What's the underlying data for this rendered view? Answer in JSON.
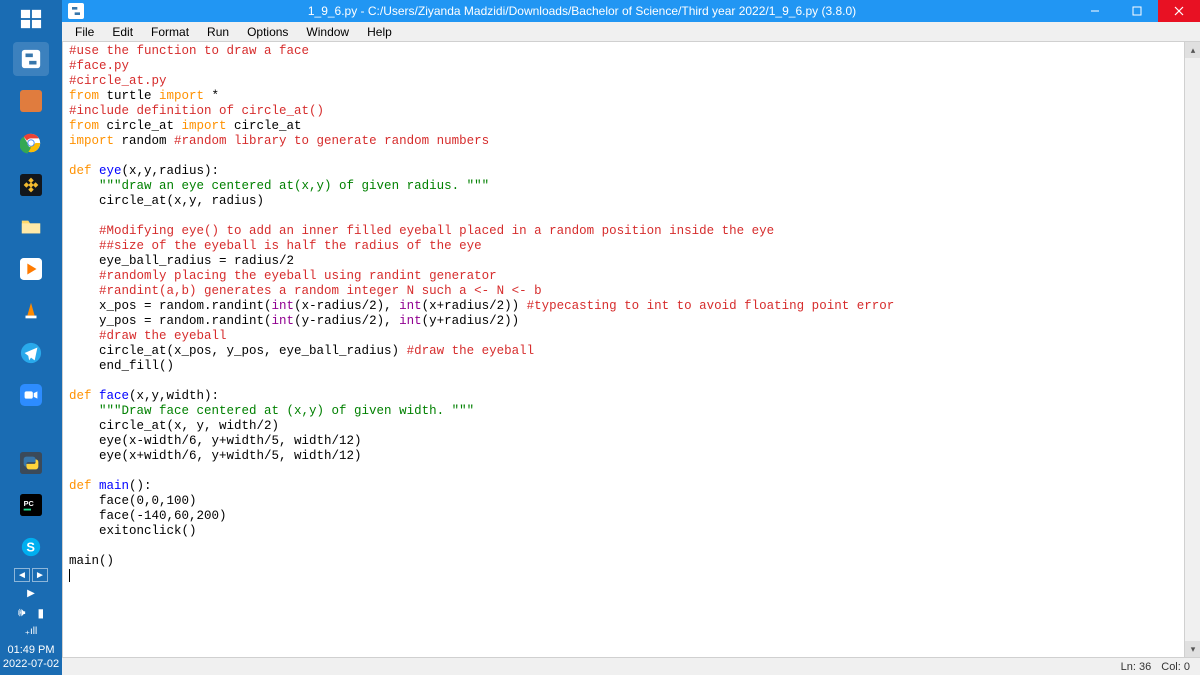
{
  "window": {
    "title": "1_9_6.py - C:/Users/Ziyanda Madzidi/Downloads/Bachelor of Science/Third year 2022/1_9_6.py (3.8.0)"
  },
  "menu": {
    "items": [
      "File",
      "Edit",
      "Format",
      "Run",
      "Options",
      "Window",
      "Help"
    ]
  },
  "code": {
    "lines": [
      [
        [
          "c-comment",
          "#use the function to draw a face"
        ]
      ],
      [
        [
          "c-comment",
          "#face.py"
        ]
      ],
      [
        [
          "c-comment",
          "#circle_at.py"
        ]
      ],
      [
        [
          "c-kw",
          "from"
        ],
        [
          "c-black",
          " turtle "
        ],
        [
          "c-kw",
          "import"
        ],
        [
          "c-black",
          " *"
        ]
      ],
      [
        [
          "c-comment",
          "#include definition of circle_at()"
        ]
      ],
      [
        [
          "c-kw",
          "from"
        ],
        [
          "c-black",
          " circle_at "
        ],
        [
          "c-kw",
          "import"
        ],
        [
          "c-black",
          " circle_at"
        ]
      ],
      [
        [
          "c-kw",
          "import"
        ],
        [
          "c-black",
          " random "
        ],
        [
          "c-comment",
          "#random library to generate random numbers"
        ]
      ],
      [
        [
          "c-black",
          ""
        ]
      ],
      [
        [
          "c-kw",
          "def"
        ],
        [
          "c-black",
          " "
        ],
        [
          "c-def",
          "eye"
        ],
        [
          "c-black",
          "(x,y,radius):"
        ]
      ],
      [
        [
          "c-black",
          "    "
        ],
        [
          "c-str",
          "\"\"\"draw an eye centered at(x,y) of given radius. \"\"\""
        ]
      ],
      [
        [
          "c-black",
          "    circle_at(x,y, radius)"
        ]
      ],
      [
        [
          "c-black",
          ""
        ]
      ],
      [
        [
          "c-black",
          "    "
        ],
        [
          "c-comment",
          "#Modifying eye() to add an inner filled eyeball placed in a random position inside the eye"
        ]
      ],
      [
        [
          "c-black",
          "    "
        ],
        [
          "c-comment",
          "##size of the eyeball is half the radius of the eye"
        ]
      ],
      [
        [
          "c-black",
          "    eye_ball_radius = radius/2"
        ]
      ],
      [
        [
          "c-black",
          "    "
        ],
        [
          "c-comment",
          "#randomly placing the eyeball using randint generator"
        ]
      ],
      [
        [
          "c-black",
          "    "
        ],
        [
          "c-comment",
          "#randint(a,b) generates a random integer N such a <- N <- b"
        ]
      ],
      [
        [
          "c-black",
          "    x_pos = random.randint("
        ],
        [
          "c-builtin",
          "int"
        ],
        [
          "c-black",
          "(x-radius/2), "
        ],
        [
          "c-builtin",
          "int"
        ],
        [
          "c-black",
          "(x+radius/2)) "
        ],
        [
          "c-comment",
          "#typecasting to int to avoid floating point error"
        ]
      ],
      [
        [
          "c-black",
          "    y_pos = random.randint("
        ],
        [
          "c-builtin",
          "int"
        ],
        [
          "c-black",
          "(y-radius/2), "
        ],
        [
          "c-builtin",
          "int"
        ],
        [
          "c-black",
          "(y+radius/2))"
        ]
      ],
      [
        [
          "c-black",
          "    "
        ],
        [
          "c-comment",
          "#draw the eyeball"
        ]
      ],
      [
        [
          "c-black",
          "    circle_at(x_pos, y_pos, eye_ball_radius) "
        ],
        [
          "c-comment",
          "#draw the eyeball"
        ]
      ],
      [
        [
          "c-black",
          "    end_fill()"
        ]
      ],
      [
        [
          "c-black",
          ""
        ]
      ],
      [
        [
          "c-kw",
          "def"
        ],
        [
          "c-black",
          " "
        ],
        [
          "c-def",
          "face"
        ],
        [
          "c-black",
          "(x,y,width):"
        ]
      ],
      [
        [
          "c-black",
          "    "
        ],
        [
          "c-str",
          "\"\"\"Draw face centered at (x,y) of given width. \"\"\""
        ]
      ],
      [
        [
          "c-black",
          "    circle_at(x, y, width/2)"
        ]
      ],
      [
        [
          "c-black",
          "    eye(x-width/6, y+width/5, width/12)"
        ]
      ],
      [
        [
          "c-black",
          "    eye(x+width/6, y+width/5, width/12)"
        ]
      ],
      [
        [
          "c-black",
          ""
        ]
      ],
      [
        [
          "c-kw",
          "def"
        ],
        [
          "c-black",
          " "
        ],
        [
          "c-def",
          "main"
        ],
        [
          "c-black",
          "():"
        ]
      ],
      [
        [
          "c-black",
          "    face(0,0,100)"
        ]
      ],
      [
        [
          "c-black",
          "    face(-140,60,200)"
        ]
      ],
      [
        [
          "c-black",
          "    exitonclick()"
        ]
      ],
      [
        [
          "c-black",
          ""
        ]
      ],
      [
        [
          "c-black",
          "main()"
        ]
      ]
    ]
  },
  "status": {
    "ln": "Ln: 36",
    "col": "Col: 0"
  },
  "taskbar": {
    "time": "01:49 PM",
    "date": "2022-07-02"
  }
}
